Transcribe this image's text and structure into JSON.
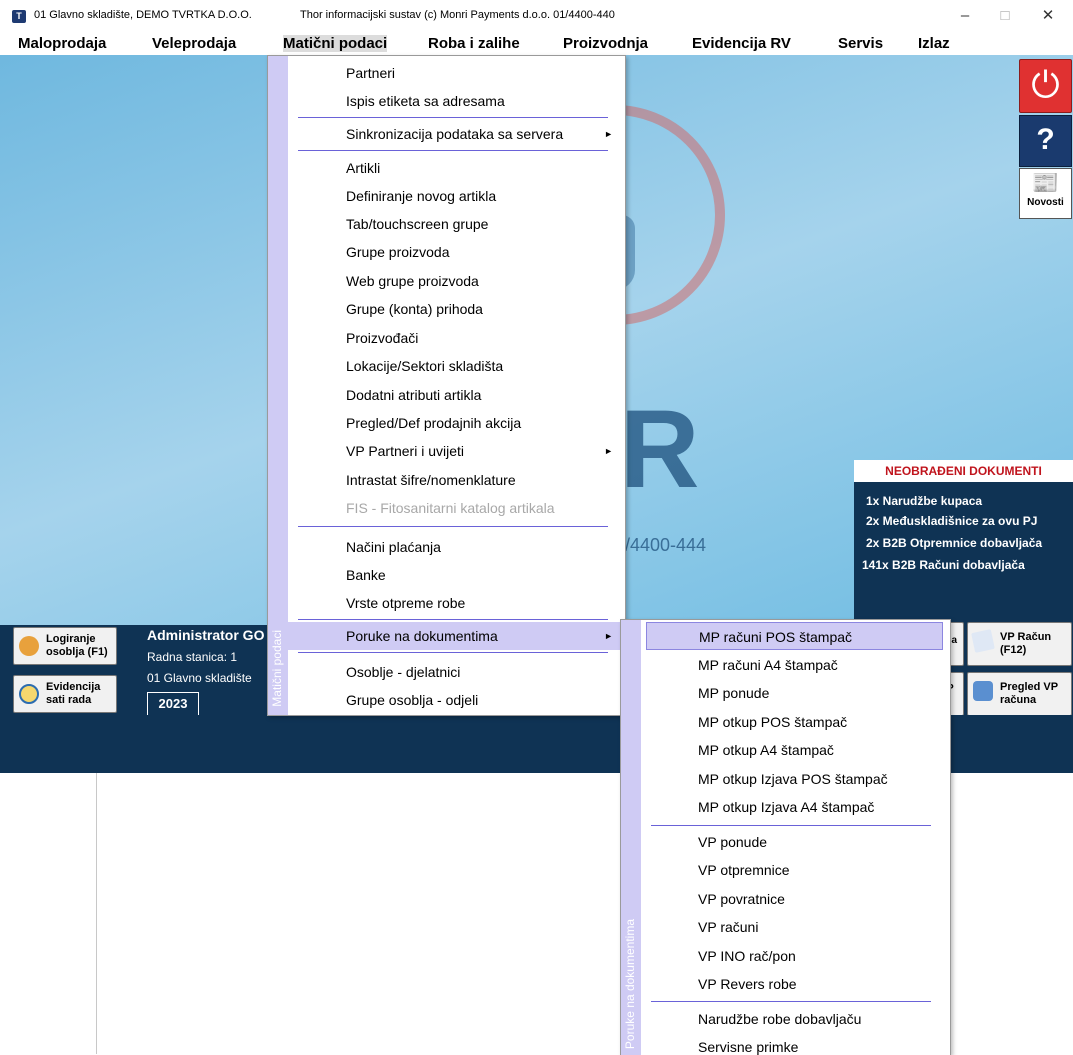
{
  "window": {
    "title_left": "01 Glavno skladište, DEMO TVRTKA D.O.O.",
    "title_center": "Thor informacijski sustav (c) Monri Payments d.o.o. 01/4400-440",
    "minimize": "–",
    "maximize": "□",
    "close": "✕"
  },
  "menubar": {
    "items": [
      "Maloprodaja",
      "Veleprodaja",
      "Matični podaci",
      "Roba i zalihe",
      "Proizvodnja",
      "Evidencija RV",
      "Servis",
      "Izlaz"
    ]
  },
  "background": {
    "logo_letter": "R",
    "logo_phone": "/4400-444"
  },
  "side_buttons": {
    "power_glyph": "⏻",
    "help_glyph": "?",
    "news_glyph": "📰",
    "news_label": "Novosti"
  },
  "docs_panel": {
    "title": "NEOBRAĐENI DOKUMENTI",
    "lines": [
      "1x Narudžbe kupaca",
      "2x Međuskladišnice za ovu PJ",
      "2x B2B Otpremnice dobavljača",
      "141x B2B Računi dobavljača"
    ]
  },
  "toolbar": {
    "login_line1": "Logiranje",
    "login_line2": "osoblja (F1)",
    "attendance_line1": "Evidencija",
    "attendance_line2": "sati rada",
    "admin_name": "Administrator GO",
    "station": "Radna stanica: 1",
    "warehouse": "01 Glavno skladište",
    "year": "2023",
    "hidden_btn1": "ca",
    "hidden_btn2": "P",
    "vp_invoice_line1": "VP Račun",
    "vp_invoice_line2": "(F12)",
    "vp_review_line1": "Pregled VP",
    "vp_review_line2": "računa"
  },
  "menu_maticni": {
    "side_label": "Matični podaci",
    "items": [
      {
        "label": "Partneri"
      },
      {
        "label": "Ispis etiketa sa adresama"
      },
      {
        "label": "Sinkronizacija podataka sa servera",
        "submenu": true
      },
      {
        "label": "Artikli"
      },
      {
        "label": "Definiranje novog artikla"
      },
      {
        "label": "Tab/touchscreen grupe"
      },
      {
        "label": "Grupe proizvoda"
      },
      {
        "label": "Web grupe proizvoda"
      },
      {
        "label": "Grupe (konta) prihoda"
      },
      {
        "label": "Proizvođači"
      },
      {
        "label": "Lokacije/Sektori skladišta"
      },
      {
        "label": "Dodatni atributi artikla"
      },
      {
        "label": "Pregled/Def prodajnih akcija"
      },
      {
        "label": "VP Partneri i uvijeti",
        "submenu": true
      },
      {
        "label": "Intrastat šifre/nomenklature"
      },
      {
        "label": "FIS - Fitosanitarni katalog artikala",
        "disabled": true
      },
      {
        "label": "Načini plaćanja"
      },
      {
        "label": "Banke"
      },
      {
        "label": "Vrste otpreme robe"
      },
      {
        "label": "Poruke na dokumentima",
        "submenu": true,
        "highlight": true
      },
      {
        "label": "Osoblje - djelatnici"
      },
      {
        "label": "Grupe osoblja - odjeli"
      }
    ],
    "arrow": "►"
  },
  "menu_poruke": {
    "side_label": "Poruke na dokumentima",
    "items": [
      {
        "label": "MP računi POS štampač",
        "selected": true
      },
      {
        "label": "MP računi A4 štampač"
      },
      {
        "label": "MP ponude"
      },
      {
        "label": "MP otkup POS štampač"
      },
      {
        "label": "MP otkup A4 štampač"
      },
      {
        "label": "MP otkup Izjava POS štampač"
      },
      {
        "label": "MP otkup Izjava A4 štampač"
      },
      {
        "label": "VP ponude"
      },
      {
        "label": "VP otpremnice"
      },
      {
        "label": "VP povratnice"
      },
      {
        "label": "VP računi"
      },
      {
        "label": "VP INO rač/pon"
      },
      {
        "label": "VP Revers robe"
      },
      {
        "label": "Narudžbe robe dobavljaču"
      },
      {
        "label": "Servisne primke"
      }
    ]
  },
  "colors": {
    "menu_highlight": "#cfcbf4",
    "separator": "#6a62d8",
    "dark_panel": "#0f3354",
    "docs_title": "#c0141d"
  }
}
